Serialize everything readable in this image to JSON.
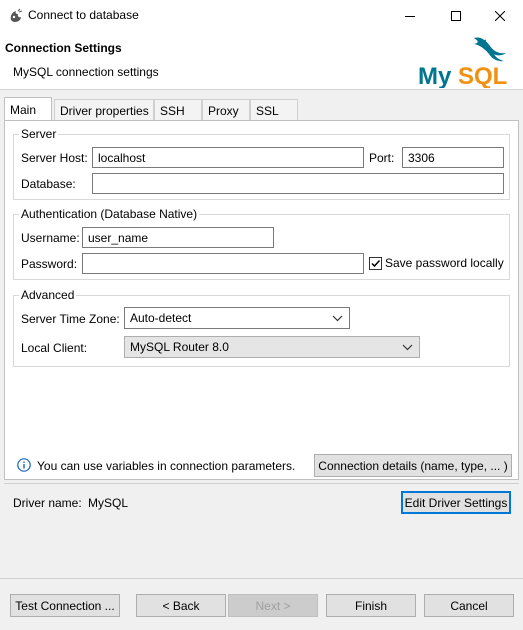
{
  "window": {
    "title": "Connect to database",
    "minimize_icon": "minimize-icon",
    "maximize_icon": "maximize-icon",
    "close_icon": "close-icon"
  },
  "header": {
    "title": "Connection Settings",
    "subtitle": "MySQL connection settings",
    "logo_text": "MySQL",
    "logo_colors": {
      "my": "#00758f",
      "sql": "#f29111"
    }
  },
  "tabs": [
    {
      "label": "Main",
      "active": true
    },
    {
      "label": "Driver properties",
      "active": false
    },
    {
      "label": "SSH",
      "active": false
    },
    {
      "label": "Proxy",
      "active": false
    },
    {
      "label": "SSL",
      "active": false
    }
  ],
  "server": {
    "group_label": "Server",
    "host_label": "Server Host:",
    "host_value": "localhost",
    "port_label": "Port:",
    "port_value": "3306",
    "database_label": "Database:",
    "database_value": ""
  },
  "auth": {
    "group_label": "Authentication (Database Native)",
    "username_label": "Username:",
    "username_value": "user_name",
    "password_label": "Password:",
    "password_value": "",
    "save_password_label": "Save password locally",
    "save_password_checked": true
  },
  "advanced": {
    "group_label": "Advanced",
    "timezone_label": "Server Time Zone:",
    "timezone_value": "Auto-detect",
    "client_label": "Local Client:",
    "client_value": "MySQL Router 8.0"
  },
  "info": {
    "icon": "info-icon",
    "text": "You can use variables in connection parameters.",
    "details_button": "Connection details (name, type, ... )"
  },
  "driver": {
    "label": "Driver name:",
    "value": "MySQL",
    "edit_button": "Edit Driver Settings"
  },
  "footer": {
    "test_button": "Test Connection ...",
    "back_button": "< Back",
    "next_button": "Next >",
    "finish_button": "Finish",
    "cancel_button": "Cancel"
  }
}
